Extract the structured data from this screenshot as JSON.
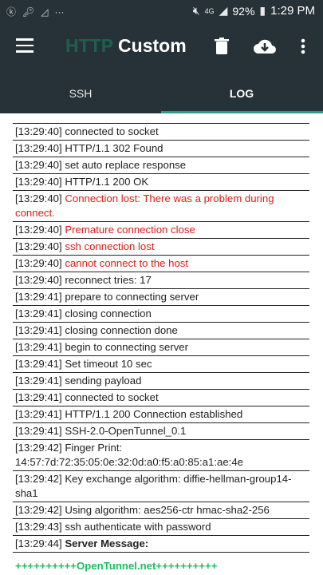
{
  "status_bar": {
    "battery": "92%",
    "time": "1:29 PM",
    "net_label": "4G",
    "colors": {
      "bg": "#263238"
    }
  },
  "app_bar": {
    "title_part1": "HTTP",
    "title_part2": "Custom",
    "icons": [
      "menu-icon",
      "trash-icon",
      "cloud-download-icon",
      "more-vert-icon"
    ]
  },
  "tabs": [
    {
      "label": "SSH",
      "active": false
    },
    {
      "label": "LOG",
      "active": true
    }
  ],
  "log": [
    {
      "time": "[13:29:40]",
      "msg": "connected to socket"
    },
    {
      "time": "[13:29:40]",
      "msg": "HTTP/1.1 302 Found"
    },
    {
      "time": "[13:29:40]",
      "msg": "set auto replace response"
    },
    {
      "time": "[13:29:40]",
      "msg": "HTTP/1.1 200 OK"
    },
    {
      "time": "[13:29:40]",
      "msg": "Connection lost: There was a problem during connect.",
      "type": "error"
    },
    {
      "time": "[13:29:40]",
      "msg": "Premature connection close",
      "type": "error"
    },
    {
      "time": "[13:29:40]",
      "msg": "ssh connection lost",
      "type": "error"
    },
    {
      "time": "[13:29:40]",
      "msg": "cannot connect to the host",
      "type": "error"
    },
    {
      "time": "[13:29:40]",
      "msg": "reconnect tries: 17"
    },
    {
      "time": "[13:29:41]",
      "msg": "prepare to connecting server"
    },
    {
      "time": "[13:29:41]",
      "msg": "closing connection"
    },
    {
      "time": "[13:29:41]",
      "msg": "closing connection done"
    },
    {
      "time": "[13:29:41]",
      "msg": "begin to connecting server"
    },
    {
      "time": "[13:29:41]",
      "msg": "Set timeout 10 sec"
    },
    {
      "time": "[13:29:41]",
      "msg": "sending payload"
    },
    {
      "time": "[13:29:41]",
      "msg": "connected to socket"
    },
    {
      "time": "[13:29:41]",
      "msg": "HTTP/1.1 200 Connection established"
    },
    {
      "time": "[13:29:41]",
      "msg": "SSH-2.0-OpenTunnel_0.1"
    },
    {
      "time": "[13:29:42]",
      "msg": "Finger Print: 14:57:7d:72:35:05:0e:32:0d:a0:f5:a0:85:a1:ae:4e"
    },
    {
      "time": "[13:29:42]",
      "msg": "Key exchange algorithm: diffie-hellman-group14-sha1"
    },
    {
      "time": "[13:29:42]",
      "msg": "Using algorithm: aes256-ctr hmac-sha2-256"
    },
    {
      "time": "[13:29:43]",
      "msg": "ssh authenticate with password"
    },
    {
      "time": "[13:29:44]",
      "msg": "Server Message:",
      "type": "bold"
    }
  ],
  "log_tail": "++++++++++OpenTunnel.net++++++++++",
  "colors": {
    "appbar": "#263238",
    "accent_title": "#1f5f4e",
    "tab_indicator": "#20a088",
    "error": "#e01a1a",
    "green": "#18c060"
  }
}
